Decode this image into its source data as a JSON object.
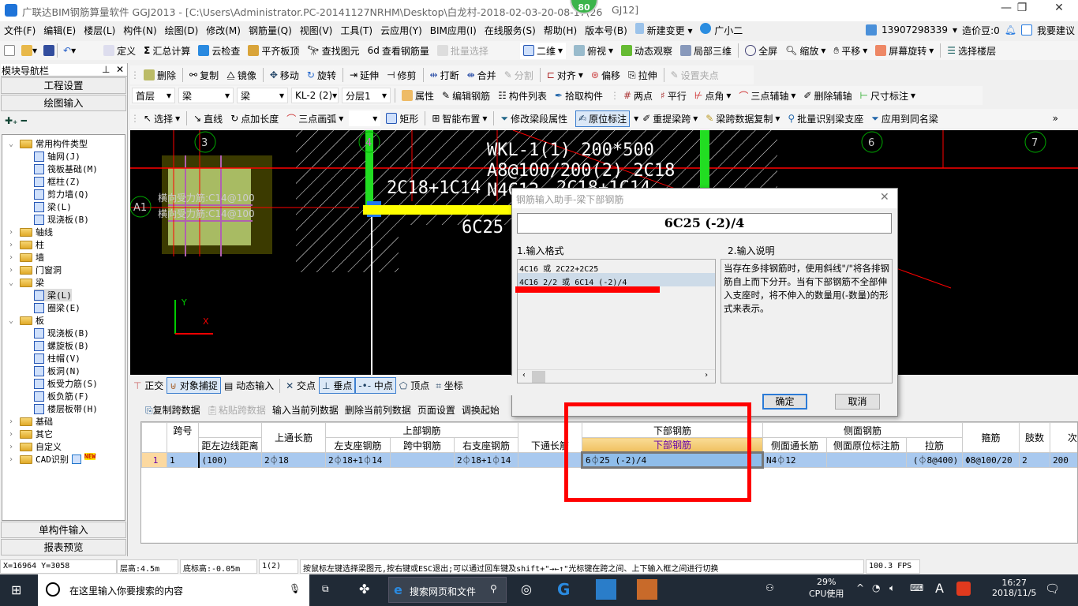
{
  "title": {
    "text": "广联达BIM钢筋算量软件 GGJ2013 - [C:\\Users\\Administrator.PC-20141127NRHM\\Desktop\\白龙村-2018-02-03-20-08-17(26",
    "suffix": "GJ12]",
    "badge": "80"
  },
  "menu": [
    "文件(F)",
    "编辑(E)",
    "楼层(L)",
    "构件(N)",
    "绘图(D)",
    "修改(M)",
    "钢筋量(Q)",
    "视图(V)",
    "工具(T)",
    "云应用(Y)",
    "BIM应用(I)",
    "在线服务(S)",
    "帮助(H)",
    "版本号(B)",
    "新建变更",
    "广小二"
  ],
  "account": {
    "phone": "13907298339",
    "beans": "造价豆:0",
    "suggest": "我要建议"
  },
  "toolbar1": [
    "定义",
    "汇总计算",
    "云检查",
    "平齐板顶",
    "查找图元",
    "查看钢筋量",
    "批量选择",
    "二维",
    "俯视",
    "动态观察",
    "局部三维",
    "全屏",
    "缩放",
    "平移",
    "屏幕旋转",
    "选择楼层"
  ],
  "toolbar2": [
    "删除",
    "复制",
    "镜像",
    "移动",
    "旋转",
    "延伸",
    "修剪",
    "打断",
    "合并",
    "分割",
    "对齐",
    "偏移",
    "拉伸",
    "设置夹点"
  ],
  "toolbar3": {
    "dropdowns": [
      "首层",
      "梁",
      "梁",
      "KL-2 (2)",
      "分层1"
    ],
    "items": [
      "属性",
      "编辑钢筋",
      "构件列表",
      "拾取构件",
      "两点",
      "平行",
      "点角",
      "三点辅轴",
      "删除辅轴",
      "尺寸标注"
    ]
  },
  "toolbar4": [
    "选择",
    "直线",
    "点加长度",
    "三点画弧",
    "矩形",
    "智能布置",
    "修改梁段属性",
    "原位标注",
    "重提梁跨",
    "梁跨数据复制",
    "批量识别梁支座",
    "应用到同名梁"
  ],
  "nav": {
    "header": "模块导航栏",
    "btn1": "工程设置",
    "btn2": "绘图输入",
    "btn3": "单构件输入",
    "btn4": "报表预览",
    "tree": [
      {
        "label": "常用构件类型",
        "level": 0,
        "type": "folder",
        "open": true
      },
      {
        "label": "轴网(J)",
        "level": 1
      },
      {
        "label": "筏板基础(M)",
        "level": 1
      },
      {
        "label": "框柱(Z)",
        "level": 1
      },
      {
        "label": "剪力墙(Q)",
        "level": 1
      },
      {
        "label": "梁(L)",
        "level": 1
      },
      {
        "label": "现浇板(B)",
        "level": 1
      },
      {
        "label": "轴线",
        "level": 0,
        "type": "folder"
      },
      {
        "label": "柱",
        "level": 0,
        "type": "folder"
      },
      {
        "label": "墙",
        "level": 0,
        "type": "folder"
      },
      {
        "label": "门窗洞",
        "level": 0,
        "type": "folder"
      },
      {
        "label": "梁",
        "level": 0,
        "type": "folder",
        "open": true
      },
      {
        "label": "梁(L)",
        "level": 1,
        "selected": true
      },
      {
        "label": "圈梁(E)",
        "level": 1
      },
      {
        "label": "板",
        "level": 0,
        "type": "folder",
        "open": true
      },
      {
        "label": "现浇板(B)",
        "level": 1
      },
      {
        "label": "螺旋板(B)",
        "level": 1
      },
      {
        "label": "柱帽(V)",
        "level": 1
      },
      {
        "label": "板洞(N)",
        "level": 1
      },
      {
        "label": "板受力筋(S)",
        "level": 1
      },
      {
        "label": "板负筋(F)",
        "level": 1
      },
      {
        "label": "楼层板带(H)",
        "level": 1
      },
      {
        "label": "基础",
        "level": 0,
        "type": "folder"
      },
      {
        "label": "其它",
        "level": 0,
        "type": "folder"
      },
      {
        "label": "自定义",
        "level": 0,
        "type": "folder"
      },
      {
        "label": "CAD识别",
        "level": 0,
        "type": "folder",
        "badge": "NEW"
      }
    ]
  },
  "cad": {
    "axes": [
      "3",
      "4",
      "6",
      "7",
      "A1"
    ],
    "texts": [
      "WKL-1(1) 200*500",
      "A8@100/200(2) 2C18",
      "N4C12",
      "2C18+1C14",
      "2C18+1C14",
      "6C25",
      "横向受力筋:C14@100",
      "横向受力筋:C14@100"
    ],
    "y_label": "Y",
    "x_label": "X"
  },
  "dialog": {
    "title": "钢筋输入助手-梁下部钢筋",
    "value": "6C25 (-2)/4",
    "format_label": "1.输入格式",
    "desc_label": "2.输入说明",
    "formats": [
      "4C16 或 2C22+2C25",
      "4C16 2/2 或 6C14 (-2)/4"
    ],
    "description": "当存在多排钢筋时，使用斜线\"/\"将各排钢筋自上而下分开。当有下部钢筋不全部伸入支座时，将不伸入的数量用(-数量)的形式来表示。",
    "ok": "确定",
    "cancel": "取消"
  },
  "snapbar": [
    "正交",
    "对象捕捉",
    "动态输入",
    "交点",
    "垂点",
    "中点",
    "顶点",
    "坐标"
  ],
  "tabletb": [
    "复制跨数据",
    "粘贴跨数据",
    "输入当前列数据",
    "删除当前列数据",
    "页面设置",
    "调换起始"
  ],
  "table": {
    "groups": {
      "top": "上部钢筋",
      "bottom": "下部钢筋",
      "side": "侧面钢筋"
    },
    "headers": {
      "span": "跨号",
      "dist": "距左边线距离",
      "top_through": "上通长筋",
      "left": "左支座钢筋",
      "mid": "跨中钢筋",
      "right": "右支座钢筋",
      "bottom_through": "下通长筋",
      "bottom": "下部钢筋",
      "side_through": "侧面通长筋",
      "side_orig": "侧面原位标注筋",
      "tie": "拉筋",
      "stirrup": "箍筋",
      "legs": "肢数",
      "sec": "次梁"
    },
    "rows": [
      {
        "idx": "1",
        "span": "1",
        "dist": "(100)",
        "top_through": "2⏀18",
        "left": "2⏀18+1⏀14",
        "mid": "",
        "right": "2⏀18+1⏀14",
        "bottom_through": "",
        "bottom": "6⏀25 (-2)/4",
        "side_through": "N4⏀12",
        "side_orig": "",
        "tie": "(⏀8@400)",
        "stirrup": "Φ8@100/20",
        "legs": "2",
        "sec": "200"
      }
    ]
  },
  "status": {
    "coords": "X=16964 Y=3058",
    "floor_h": "层高:4.5m",
    "base_h": "底标高:-0.05m",
    "span": "1(2)",
    "hint": "按鼠标左键选择梁图元,按右键或ESC退出;可以通过回车键及shift+\"→←↑\"光标键在跨之间、上下输入框之间进行切换",
    "fps": "100.3 FPS"
  },
  "taskbar": {
    "search": "在这里输入你要搜索的内容",
    "browser_search": "搜索网页和文件",
    "cpu": "29%",
    "cpu_label": "CPU使用",
    "time": "16:27",
    "date": "2018/11/5",
    "ime": "A"
  },
  "colors": {
    "annotation": "#ff0000",
    "cad_bg": "#000000",
    "selected_row": "#a9c9ef",
    "header_active": "#f5c96a"
  }
}
